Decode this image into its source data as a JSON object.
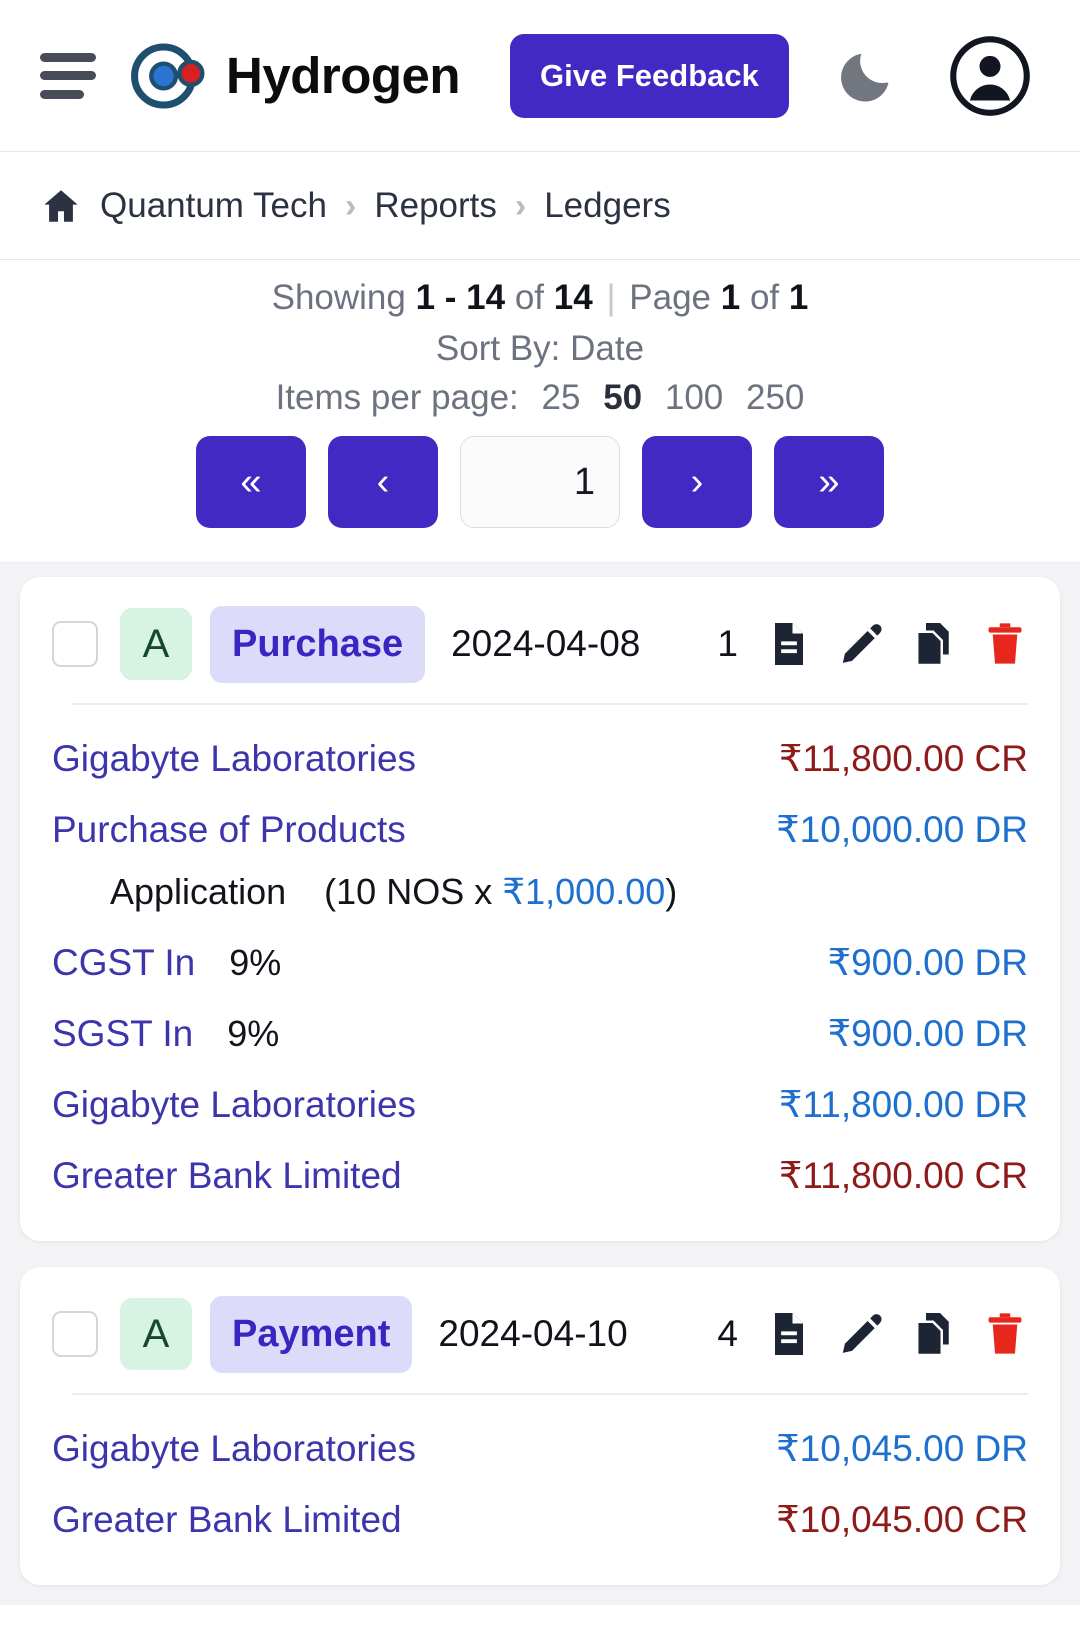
{
  "header": {
    "menu_icon": "hamburger-icon",
    "logo_icon": "hydrogen-logo-icon",
    "brand": "Hydrogen",
    "feedback_label": "Give Feedback",
    "theme_icon": "moon-icon",
    "account_icon": "account-circle-icon"
  },
  "breadcrumb": {
    "home_icon": "home-icon",
    "separator": "›",
    "items": [
      {
        "label": "Quantum Tech"
      },
      {
        "label": "Reports"
      },
      {
        "label": "Ledgers"
      }
    ]
  },
  "pager": {
    "showing_label": "Showing",
    "range": "1 - 14",
    "of_label": "of",
    "total": "14",
    "divider": "|",
    "page_label": "Page",
    "page_current": "1",
    "page_of_label": "of",
    "page_total": "1",
    "sort_by": "Sort By: Date",
    "items_per_page_label": "Items per page:",
    "items_per_page_options": [
      "25",
      "50",
      "100",
      "250"
    ],
    "items_per_page_selected": "50",
    "first_label": "«",
    "prev_label": "‹",
    "next_label": "›",
    "last_label": "»",
    "page_input_value": "1"
  },
  "cards": [
    {
      "status_badge": "A",
      "type_badge": "Purchase",
      "date": "2024-04-08",
      "count": "1",
      "actions": [
        "receipt-icon",
        "edit-icon",
        "duplicate-icon",
        "delete-icon"
      ],
      "rows": [
        {
          "name": "Gigabyte Laboratories",
          "rate": "",
          "amount": "₹11,800.00 CR",
          "kind": "cr"
        },
        {
          "name": "Purchase of Products",
          "rate": "",
          "amount": "₹10,000.00 DR",
          "kind": "dr",
          "sub": {
            "item": "Application",
            "qty": "(10 NOS x ",
            "price": "₹1,000.00",
            "close": ")"
          }
        },
        {
          "name": "CGST In",
          "rate": "9%",
          "amount": "₹900.00 DR",
          "kind": "dr"
        },
        {
          "name": "SGST In",
          "rate": "9%",
          "amount": "₹900.00 DR",
          "kind": "dr"
        },
        {
          "name": "Gigabyte Laboratories",
          "rate": "",
          "amount": "₹11,800.00 DR",
          "kind": "dr"
        },
        {
          "name": "Greater Bank Limited",
          "rate": "",
          "amount": "₹11,800.00 CR",
          "kind": "cr"
        }
      ]
    },
    {
      "status_badge": "A",
      "type_badge": "Payment",
      "date": "2024-04-10",
      "count": "4",
      "actions": [
        "receipt-icon",
        "edit-icon",
        "duplicate-icon",
        "delete-icon"
      ],
      "rows": [
        {
          "name": "Gigabyte Laboratories",
          "rate": "",
          "amount": "₹10,045.00 DR",
          "kind": "dr"
        },
        {
          "name": "Greater Bank Limited",
          "rate": "",
          "amount": "₹10,045.00 CR",
          "kind": "cr"
        }
      ]
    }
  ],
  "colors": {
    "accent": "#4229c4",
    "ledger_link": "#3d35ab",
    "debit": "#1f6fce",
    "credit": "#8e1b19",
    "badge_active_bg": "#d6f3e3",
    "badge_type_bg": "#dcdcfa",
    "delete": "#e8271c"
  }
}
